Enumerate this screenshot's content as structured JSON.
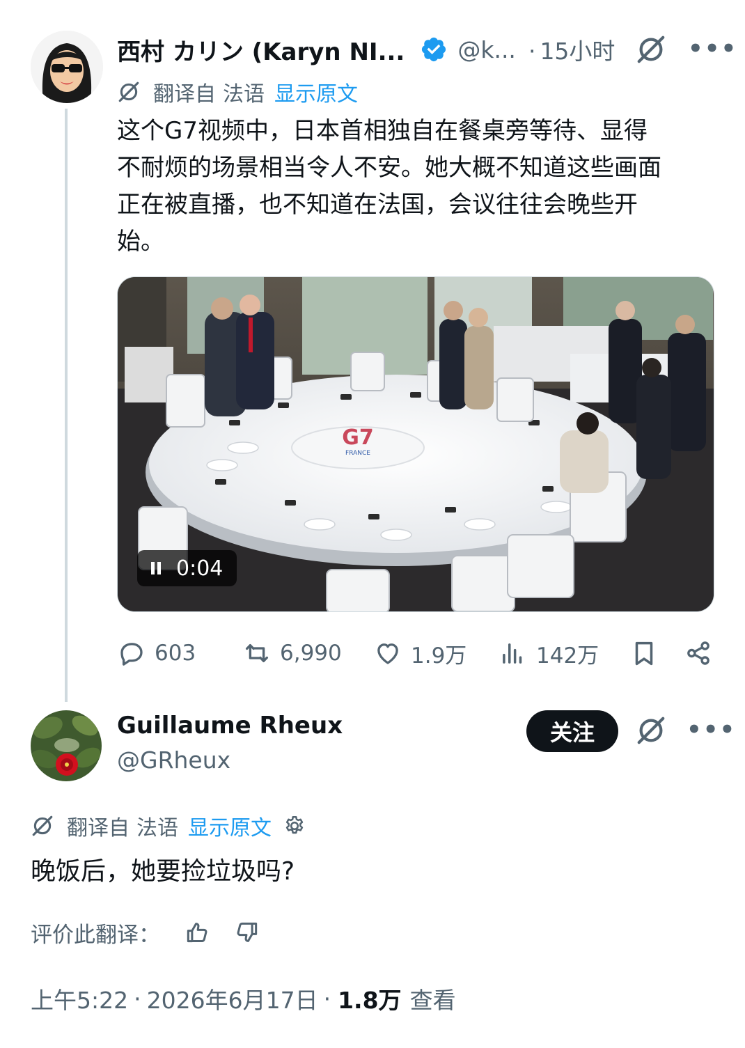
{
  "tweet": {
    "author": {
      "display_name": "西村 カリン (Karyn NI...",
      "handle": "@k...",
      "verified": true,
      "avatar_icon": "cartoon-woman-sunglasses-avatar"
    },
    "time_separator": "·",
    "time": "15小时",
    "translation": {
      "label": "翻译自",
      "language": "法语",
      "show_original": "显示原文"
    },
    "text_lines": [
      "这个G7视频中，日本首相独自在餐桌旁等待、显得",
      "不耐烦的场景相当令人不安。她大概不知道这些画面",
      "正在被直播，也不知道在法国，会议往往会晚些开",
      "始。"
    ],
    "media": {
      "type": "video",
      "elapsed": "0:04",
      "logo_text": "G7",
      "logo_sub": "FRANCE"
    },
    "stats": {
      "replies": "603",
      "reposts": "6,990",
      "likes": "1.9万",
      "views": "142万"
    }
  },
  "reply": {
    "author": {
      "display_name": "Guillaume Rheux",
      "handle": "@GRheux",
      "avatar_icon": "red-camellia-flower-avatar"
    },
    "follow_label": "关注",
    "translation": {
      "label": "翻译自",
      "language": "法语",
      "show_original": "显示原文"
    },
    "text": "晚饭后，她要捡垃圾吗?",
    "rate_label": "评价此翻译：",
    "meta": {
      "time": "上午5:22",
      "separator": "·",
      "date": "2026年6月17日",
      "views_count": "1.8万",
      "views_label": "查看"
    }
  },
  "colors": {
    "text_primary": "#0f1419",
    "text_secondary": "#536471",
    "link_blue": "#1d9bf0",
    "verified_blue": "#1d9bf0",
    "thread_line": "#cfd9de",
    "follow_button": "#0f1419"
  }
}
